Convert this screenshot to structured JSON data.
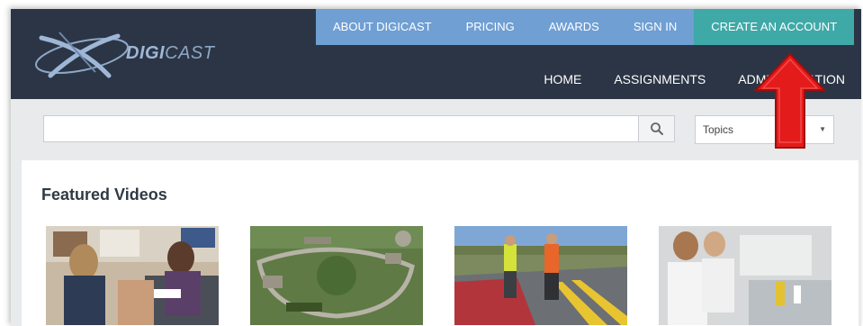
{
  "brand": {
    "name_bold": "DIGI",
    "name_rest": "CAST"
  },
  "top_nav": {
    "about": "ABOUT DIGICAST",
    "pricing": "PRICING",
    "awards": "AWARDS",
    "sign_in": "SIGN IN",
    "create_account": "CREATE AN ACCOUNT"
  },
  "main_nav": {
    "home": "HOME",
    "assignments": "ASSIGNMENTS",
    "administration": "ADMINISTRATION"
  },
  "search": {
    "value": "",
    "placeholder": ""
  },
  "topics_select": {
    "selected": "Topics"
  },
  "featured": {
    "heading": "Featured Videos",
    "videos": [
      {
        "subject": "front-desk-check-in"
      },
      {
        "subject": "aerial-campus"
      },
      {
        "subject": "airfield-runway-workers"
      },
      {
        "subject": "laboratory-staff"
      }
    ]
  },
  "colors": {
    "header_bg": "#2b3545",
    "top_nav_bg": "#6f9fd3",
    "create_account_bg": "#3fa9a8",
    "annotation_arrow": "#e31b1b"
  }
}
